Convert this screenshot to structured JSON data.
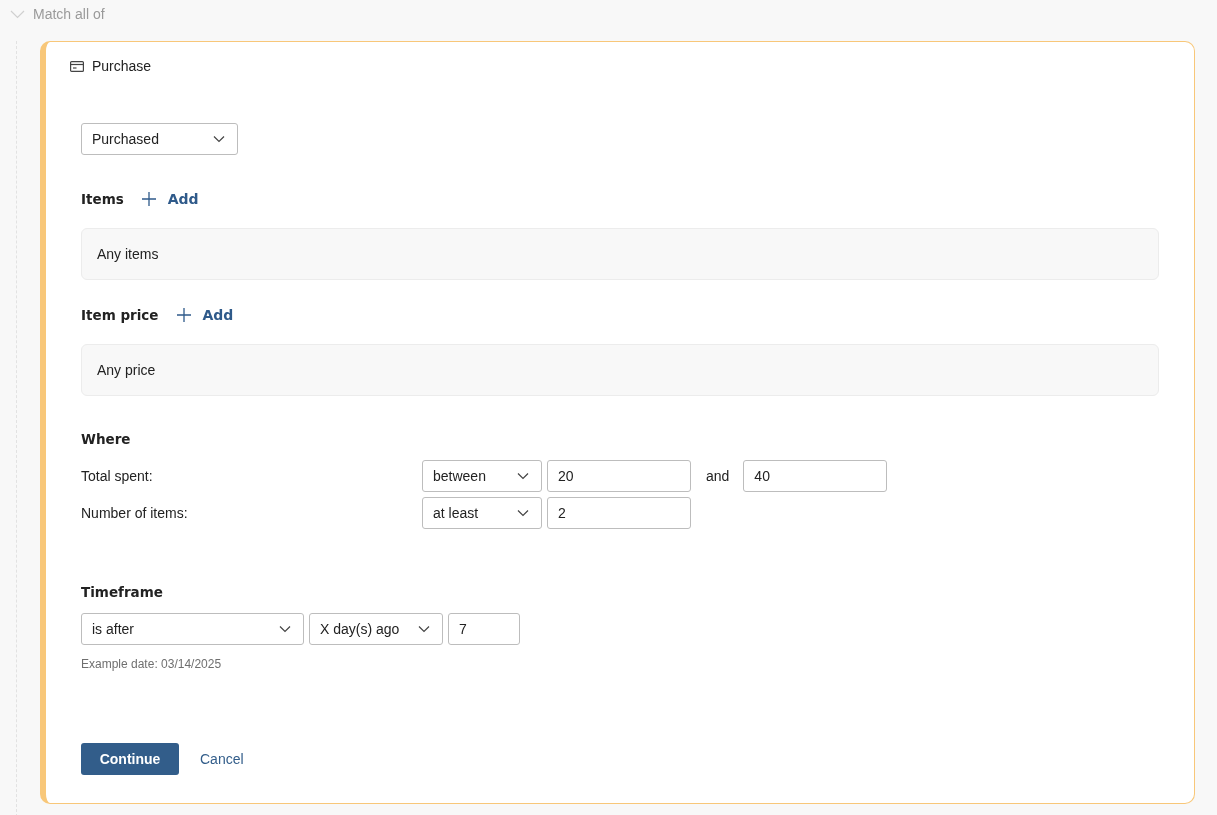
{
  "group_header": {
    "label": "Match all of"
  },
  "card": {
    "title": "Purchase",
    "action": {
      "value": "Purchased"
    },
    "sections": [
      {
        "label": "Items",
        "add_label": "Add",
        "summary": "Any items"
      },
      {
        "label": "Item price",
        "add_label": "Add",
        "summary": "Any price"
      }
    ],
    "where": {
      "title": "Where",
      "rows": [
        {
          "label": "Total spent:",
          "operator": "between",
          "value": "20",
          "joiner": "and",
          "value2": "40"
        },
        {
          "label": "Number of items:",
          "operator": "at least",
          "value": "2"
        }
      ]
    },
    "timeframe": {
      "title": "Timeframe",
      "operator": "is after",
      "unit": "X day(s) ago",
      "value": "7",
      "hint": "Example date: 03/14/2025"
    },
    "buttons": [
      {
        "label": "Continue",
        "kind": "primary"
      },
      {
        "label": "Cancel",
        "kind": "link"
      }
    ]
  }
}
